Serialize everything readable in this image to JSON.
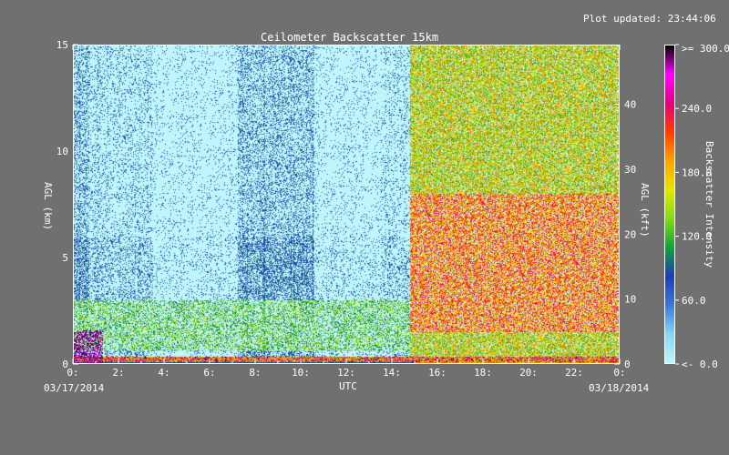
{
  "updated": "Plot updated: 23:44:06",
  "chart_data": {
    "type": "heatmap",
    "title": "Ceilometer Backscatter 15km",
    "xlabel": "UTC",
    "ylabel_left": "AGL (km)",
    "ylabel_right": "AGL (kft)",
    "x_ticks": [
      "0:",
      "2:",
      "4:",
      "6:",
      "8:",
      "10:",
      "12:",
      "14:",
      "16:",
      "18:",
      "20:",
      "22:",
      "0:"
    ],
    "x_range_hours": [
      0,
      24
    ],
    "y_left_ticks": [
      "0",
      "5",
      "10",
      "15"
    ],
    "y_left_range": [
      0,
      15
    ],
    "y_right_ticks": [
      "0",
      "10",
      "20",
      "30",
      "40"
    ],
    "y_right_range_kft": [
      0,
      49.2
    ],
    "date_start": "03/17/2014",
    "date_end": "03/18/2014",
    "colorbar": {
      "label": "Backscatter Intensity",
      "ticks": [
        "<-   0.0",
        "60.0",
        "120.0",
        "180.0",
        "240.0",
        ">= 300.0"
      ],
      "range": [
        0,
        300
      ],
      "colors": [
        "#bff5fb",
        "#87d7f5",
        "#3c78d8",
        "#1e3cb4",
        "#14a03c",
        "#82dc14",
        "#e6e600",
        "#ffa500",
        "#ff3c00",
        "#e1007d",
        "#ff00ff",
        "#000000"
      ]
    },
    "background_color": "#bff5fb"
  }
}
